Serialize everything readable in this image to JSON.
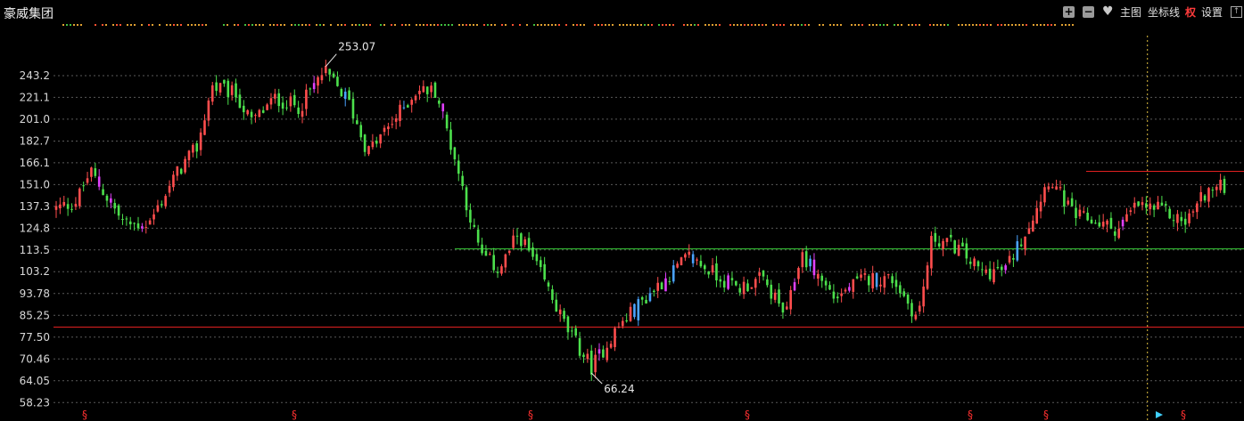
{
  "header": {
    "stock_name": "豪威集团",
    "plus_label": "+",
    "minus_label": "−",
    "main_chart_label": "主图",
    "axis_label": "坐标线",
    "quan_label": "权",
    "settings_label": "设置",
    "colors": {
      "up": "#ff4d4d",
      "down": "#54ff54",
      "accent": "#ff3b3b"
    }
  },
  "chart_data": {
    "type": "candlestick",
    "title": "",
    "xlabel": "",
    "ylabel": "",
    "y_scale": "log",
    "ylim": [
      56.5,
      268
    ],
    "y_ticks": [
      "243.2",
      "221.1",
      "201.0",
      "182.7",
      "166.1",
      "151.0",
      "137.3",
      "124.8",
      "113.5",
      "103.2",
      "93.78",
      "85.25",
      "77.50",
      "70.46",
      "64.05",
      "58.23"
    ],
    "grid": "horizontal-dashed",
    "annotations": [
      {
        "label": "253.07",
        "value": 253.07,
        "position": "high"
      },
      {
        "label": "66.24",
        "value": 66.24,
        "position": "low"
      }
    ],
    "horizontal_lines": [
      {
        "value": 114.0,
        "color": "#37d137"
      },
      {
        "value": 81.0,
        "color": "#e02020"
      },
      {
        "value": 160.0,
        "color": "#e02020"
      }
    ],
    "crosshair_x_fraction": 0.935,
    "event_marker_symbol": "§",
    "event_marker_color": "#ff3030",
    "event_marker_count": 7,
    "price_path": [
      [
        0,
        136
      ],
      [
        0.02,
        140
      ],
      [
        0.035,
        160
      ],
      [
        0.05,
        145
      ],
      [
        0.07,
        127
      ],
      [
        0.095,
        127
      ],
      [
        0.125,
        160
      ],
      [
        0.145,
        178
      ],
      [
        0.16,
        232
      ],
      [
        0.185,
        224
      ],
      [
        0.2,
        198
      ],
      [
        0.225,
        220
      ],
      [
        0.25,
        212
      ],
      [
        0.275,
        248
      ],
      [
        0.3,
        218
      ],
      [
        0.32,
        174
      ],
      [
        0.345,
        198
      ],
      [
        0.37,
        228
      ],
      [
        0.39,
        228
      ],
      [
        0.41,
        168
      ],
      [
        0.435,
        112
      ],
      [
        0.455,
        104
      ],
      [
        0.475,
        122
      ],
      [
        0.5,
        100
      ],
      [
        0.525,
        80
      ],
      [
        0.55,
        68
      ],
      [
        0.575,
        80
      ],
      [
        0.6,
        90
      ],
      [
        0.625,
        100
      ],
      [
        0.65,
        110
      ],
      [
        0.685,
        100
      ],
      [
        0.7,
        96
      ],
      [
        0.725,
        100
      ],
      [
        0.75,
        85
      ],
      [
        0.765,
        112
      ],
      [
        0.8,
        92
      ],
      [
        0.83,
        100
      ],
      [
        0.86,
        100
      ],
      [
        0.885,
        84
      ],
      [
        0.9,
        120
      ],
      [
        0.925,
        115
      ],
      [
        0.95,
        103
      ],
      [
        0.975,
        104
      ],
      [
        1.0,
        128
      ],
      [
        1.02,
        156
      ],
      [
        1.045,
        132
      ],
      [
        1.07,
        128
      ],
      [
        1.09,
        124
      ],
      [
        1.11,
        138
      ],
      [
        1.135,
        135
      ],
      [
        1.16,
        128
      ],
      [
        1.18,
        146
      ],
      [
        1.2,
        150
      ]
    ]
  }
}
